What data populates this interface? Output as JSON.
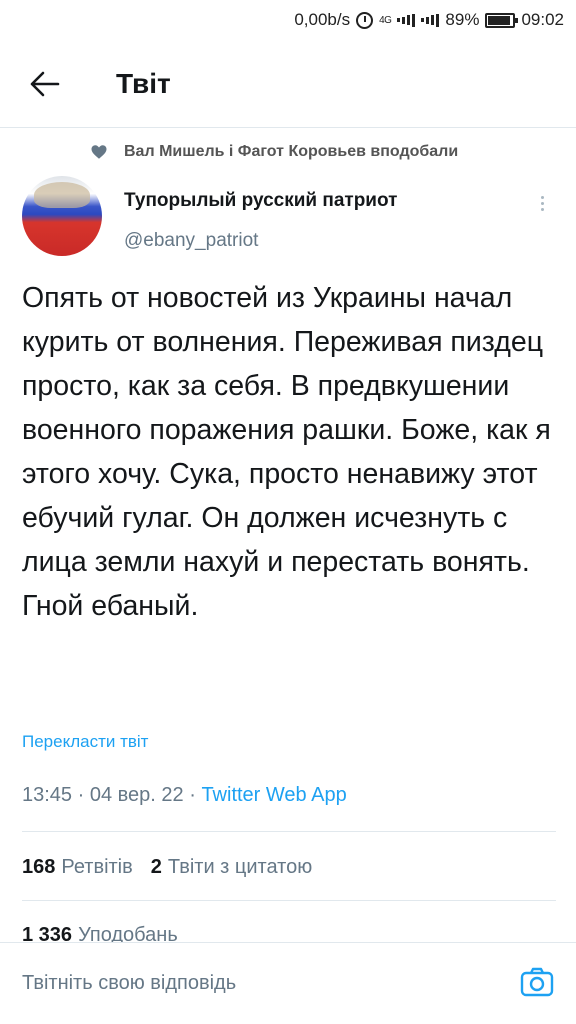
{
  "status_bar": {
    "speed": "0,00b/s",
    "network": "4G",
    "battery": "89%",
    "time": "09:02"
  },
  "header": {
    "title": "Твіт"
  },
  "liked_by": "Вал Мишель і Фагот Коровьев вподобали",
  "author": {
    "name": "Тупорылый русский патриот",
    "handle": "@ebany_patriot"
  },
  "tweet_text": "Опять от новостей из Украины начал курить от волнения. Переживая пиздец просто, как за себя. В предвкушении военного поражения рашки. Боже, как я этого хочу. Сука, просто ненавижу этот ебучий гулаг. Он должен исчезнуть с лица земли нахуй и перестать вонять. Гной ебаный.",
  "translate_label": "Перекласти твіт",
  "meta": {
    "time": "13:45",
    "date": "04 вер. 22",
    "source": "Twitter Web App"
  },
  "stats": {
    "retweets_count": "168",
    "retweets_label": "Ретвітів",
    "quotes_count": "2",
    "quotes_label": "Твіти з цитатою",
    "likes_count": "1 336",
    "likes_label": "Уподобань"
  },
  "reply": {
    "placeholder": "Твітніть свою відповідь"
  },
  "colors": {
    "accent": "#1da1f2",
    "secondary_text": "#657786",
    "divider": "#e1e8ed"
  }
}
